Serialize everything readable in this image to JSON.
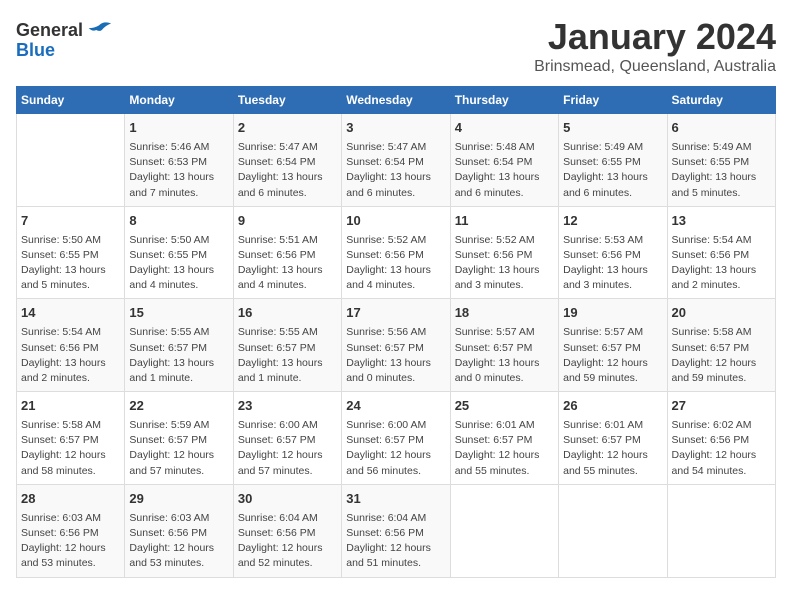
{
  "header": {
    "logo_general": "General",
    "logo_blue": "Blue",
    "title": "January 2024",
    "subtitle": "Brinsmead, Queensland, Australia"
  },
  "weekdays": [
    "Sunday",
    "Monday",
    "Tuesday",
    "Wednesday",
    "Thursday",
    "Friday",
    "Saturday"
  ],
  "weeks": [
    [
      {
        "day": "",
        "info": ""
      },
      {
        "day": "1",
        "info": "Sunrise: 5:46 AM\nSunset: 6:53 PM\nDaylight: 13 hours\nand 7 minutes."
      },
      {
        "day": "2",
        "info": "Sunrise: 5:47 AM\nSunset: 6:54 PM\nDaylight: 13 hours\nand 6 minutes."
      },
      {
        "day": "3",
        "info": "Sunrise: 5:47 AM\nSunset: 6:54 PM\nDaylight: 13 hours\nand 6 minutes."
      },
      {
        "day": "4",
        "info": "Sunrise: 5:48 AM\nSunset: 6:54 PM\nDaylight: 13 hours\nand 6 minutes."
      },
      {
        "day": "5",
        "info": "Sunrise: 5:49 AM\nSunset: 6:55 PM\nDaylight: 13 hours\nand 6 minutes."
      },
      {
        "day": "6",
        "info": "Sunrise: 5:49 AM\nSunset: 6:55 PM\nDaylight: 13 hours\nand 5 minutes."
      }
    ],
    [
      {
        "day": "7",
        "info": "Sunrise: 5:50 AM\nSunset: 6:55 PM\nDaylight: 13 hours\nand 5 minutes."
      },
      {
        "day": "8",
        "info": "Sunrise: 5:50 AM\nSunset: 6:55 PM\nDaylight: 13 hours\nand 4 minutes."
      },
      {
        "day": "9",
        "info": "Sunrise: 5:51 AM\nSunset: 6:56 PM\nDaylight: 13 hours\nand 4 minutes."
      },
      {
        "day": "10",
        "info": "Sunrise: 5:52 AM\nSunset: 6:56 PM\nDaylight: 13 hours\nand 4 minutes."
      },
      {
        "day": "11",
        "info": "Sunrise: 5:52 AM\nSunset: 6:56 PM\nDaylight: 13 hours\nand 3 minutes."
      },
      {
        "day": "12",
        "info": "Sunrise: 5:53 AM\nSunset: 6:56 PM\nDaylight: 13 hours\nand 3 minutes."
      },
      {
        "day": "13",
        "info": "Sunrise: 5:54 AM\nSunset: 6:56 PM\nDaylight: 13 hours\nand 2 minutes."
      }
    ],
    [
      {
        "day": "14",
        "info": "Sunrise: 5:54 AM\nSunset: 6:56 PM\nDaylight: 13 hours\nand 2 minutes."
      },
      {
        "day": "15",
        "info": "Sunrise: 5:55 AM\nSunset: 6:57 PM\nDaylight: 13 hours\nand 1 minute."
      },
      {
        "day": "16",
        "info": "Sunrise: 5:55 AM\nSunset: 6:57 PM\nDaylight: 13 hours\nand 1 minute."
      },
      {
        "day": "17",
        "info": "Sunrise: 5:56 AM\nSunset: 6:57 PM\nDaylight: 13 hours\nand 0 minutes."
      },
      {
        "day": "18",
        "info": "Sunrise: 5:57 AM\nSunset: 6:57 PM\nDaylight: 13 hours\nand 0 minutes."
      },
      {
        "day": "19",
        "info": "Sunrise: 5:57 AM\nSunset: 6:57 PM\nDaylight: 12 hours\nand 59 minutes."
      },
      {
        "day": "20",
        "info": "Sunrise: 5:58 AM\nSunset: 6:57 PM\nDaylight: 12 hours\nand 59 minutes."
      }
    ],
    [
      {
        "day": "21",
        "info": "Sunrise: 5:58 AM\nSunset: 6:57 PM\nDaylight: 12 hours\nand 58 minutes."
      },
      {
        "day": "22",
        "info": "Sunrise: 5:59 AM\nSunset: 6:57 PM\nDaylight: 12 hours\nand 57 minutes."
      },
      {
        "day": "23",
        "info": "Sunrise: 6:00 AM\nSunset: 6:57 PM\nDaylight: 12 hours\nand 57 minutes."
      },
      {
        "day": "24",
        "info": "Sunrise: 6:00 AM\nSunset: 6:57 PM\nDaylight: 12 hours\nand 56 minutes."
      },
      {
        "day": "25",
        "info": "Sunrise: 6:01 AM\nSunset: 6:57 PM\nDaylight: 12 hours\nand 55 minutes."
      },
      {
        "day": "26",
        "info": "Sunrise: 6:01 AM\nSunset: 6:57 PM\nDaylight: 12 hours\nand 55 minutes."
      },
      {
        "day": "27",
        "info": "Sunrise: 6:02 AM\nSunset: 6:56 PM\nDaylight: 12 hours\nand 54 minutes."
      }
    ],
    [
      {
        "day": "28",
        "info": "Sunrise: 6:03 AM\nSunset: 6:56 PM\nDaylight: 12 hours\nand 53 minutes."
      },
      {
        "day": "29",
        "info": "Sunrise: 6:03 AM\nSunset: 6:56 PM\nDaylight: 12 hours\nand 53 minutes."
      },
      {
        "day": "30",
        "info": "Sunrise: 6:04 AM\nSunset: 6:56 PM\nDaylight: 12 hours\nand 52 minutes."
      },
      {
        "day": "31",
        "info": "Sunrise: 6:04 AM\nSunset: 6:56 PM\nDaylight: 12 hours\nand 51 minutes."
      },
      {
        "day": "",
        "info": ""
      },
      {
        "day": "",
        "info": ""
      },
      {
        "day": "",
        "info": ""
      }
    ]
  ]
}
